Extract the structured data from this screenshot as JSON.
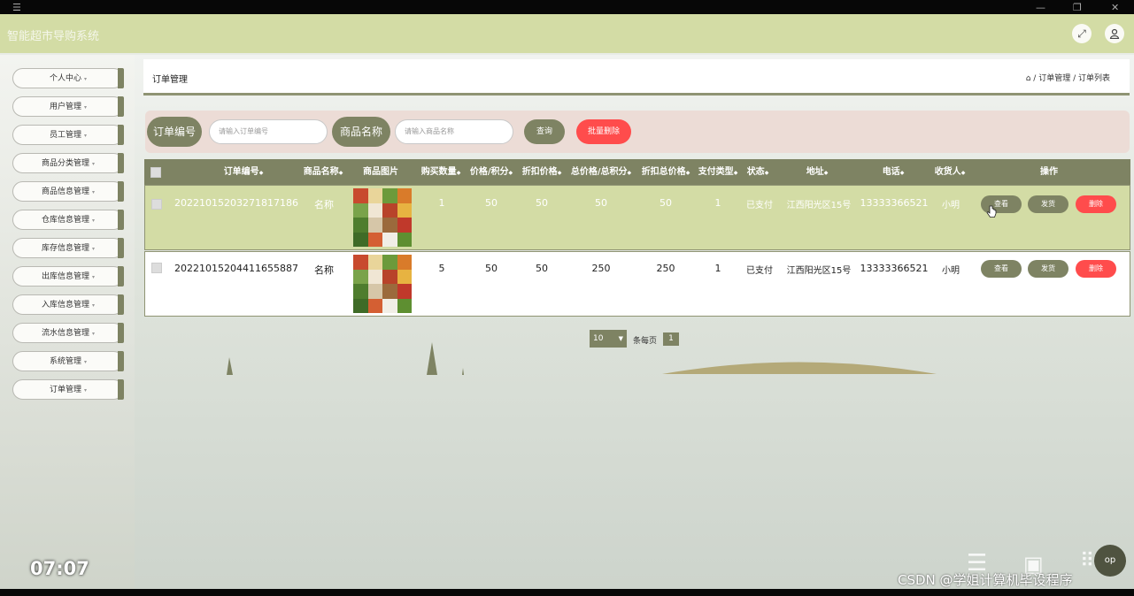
{
  "app": {
    "title": "智能超市导购系统"
  },
  "header": {
    "fullscreen_icon": "expand-icon",
    "user_icon": "user-icon"
  },
  "sidebar": {
    "items": [
      {
        "label": "个人中心"
      },
      {
        "label": "用户管理"
      },
      {
        "label": "员工管理"
      },
      {
        "label": "商品分类管理"
      },
      {
        "label": "商品信息管理"
      },
      {
        "label": "仓库信息管理"
      },
      {
        "label": "库存信息管理"
      },
      {
        "label": "出库信息管理"
      },
      {
        "label": "入库信息管理"
      },
      {
        "label": "流水信息管理"
      },
      {
        "label": "系统管理"
      },
      {
        "label": "订单管理"
      }
    ],
    "arrow": "▾"
  },
  "page": {
    "title": "订单管理",
    "breadcrumb": {
      "home_icon": "home-icon",
      "sep": " / ",
      "level1": "订单管理",
      "level2": "订单列表"
    }
  },
  "search": {
    "order_label": "订单编号",
    "order_placeholder": "请输入订单编号",
    "product_label": "商品名称",
    "product_placeholder": "请输入商品名称",
    "query_button": "查询",
    "batch_delete_button": "批量删除"
  },
  "table": {
    "columns": [
      "订单编号",
      "商品名称",
      "商品图片",
      "购买数量",
      "价格/积分",
      "折扣价格",
      "总价格/总积分",
      "折扣总价格",
      "支付类型",
      "状态",
      "地址",
      "电话",
      "收货人",
      "操作"
    ],
    "sort_mark": "◆",
    "rows": [
      {
        "order_no": "20221015203271817186",
        "name": "名称",
        "qty": "1",
        "price": "50",
        "discount": "50",
        "total": "50",
        "discount_total": "50",
        "pay_type": "1",
        "status": "已支付",
        "address": "江西阳光区15号",
        "phone": "13333366521",
        "receiver": "小明"
      },
      {
        "order_no": "20221015204411655887",
        "name": "名称",
        "qty": "5",
        "price": "50",
        "discount": "50",
        "total": "250",
        "discount_total": "250",
        "pay_type": "1",
        "status": "已支付",
        "address": "江西阳光区15号",
        "phone": "13333366521",
        "receiver": "小明"
      }
    ],
    "actions": {
      "view": "查看",
      "ship": "发货",
      "delete": "删除"
    }
  },
  "pagination": {
    "page_size": "10",
    "per_page_label": "条每页",
    "current_page": "1"
  },
  "overlay": {
    "timer": "07:07",
    "watermark": "CSDN @学姐计算机毕设程序",
    "top_button": "op"
  },
  "colors": {
    "accent": "#7e8363",
    "header": "#d3dca5",
    "danger": "#ff4c4c",
    "selected_row": "#d3dca5"
  }
}
